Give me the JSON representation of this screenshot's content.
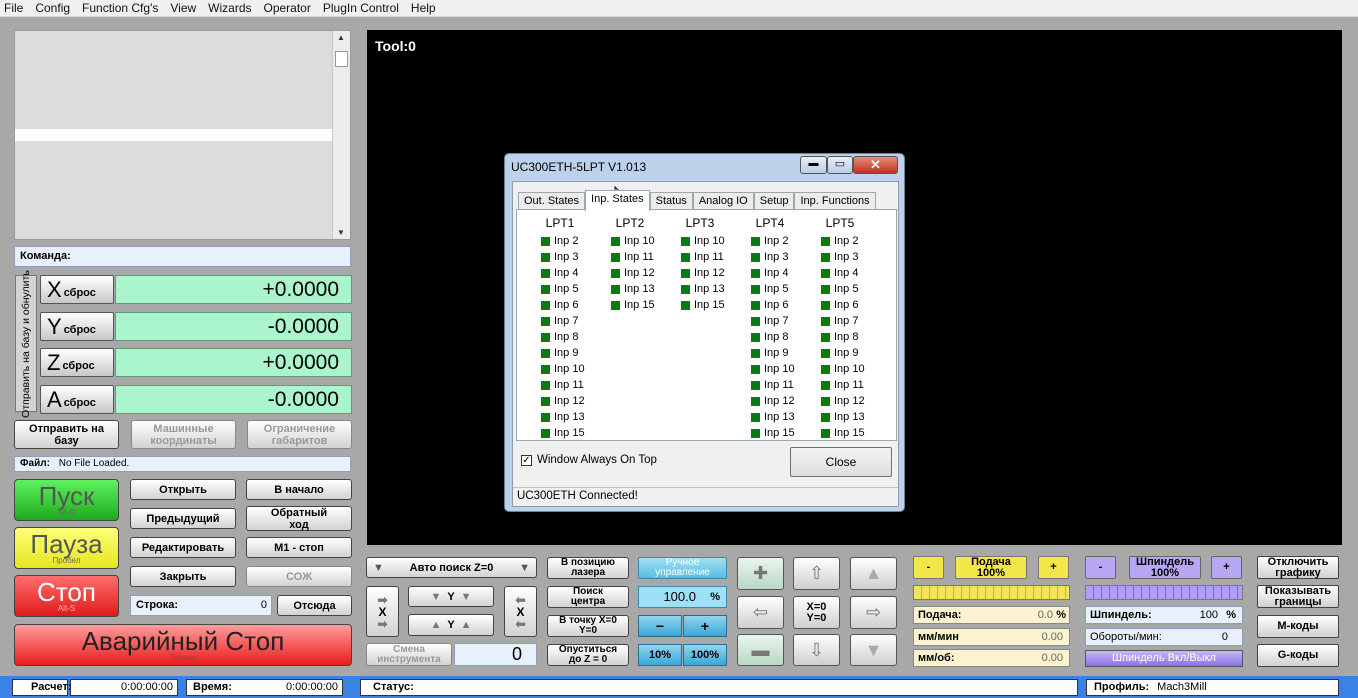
{
  "menu": [
    "File",
    "Config",
    "Function Cfg's",
    "View",
    "Wizards",
    "Operator",
    "PlugIn Control",
    "Help"
  ],
  "command_label": "Команда:",
  "ref_all_label": "Отправить на базу и обнулить",
  "axes": [
    {
      "letter": "X",
      "reset": "сброс",
      "value": "+0.0000"
    },
    {
      "letter": "Y",
      "reset": "сброс",
      "value": "-0.0000"
    },
    {
      "letter": "Z",
      "reset": "сброс",
      "value": "+0.0000"
    },
    {
      "letter": "A",
      "reset": "сброс",
      "value": "-0.0000"
    }
  ],
  "ref_buttons": {
    "home": "Отправить на базу",
    "machine": "Машинные координаты",
    "limits": "Ограничение габаритов"
  },
  "file_label": "Файл:",
  "file_value": "No File Loaded.",
  "run": {
    "start": "Пуск",
    "start_key": "Alt-R",
    "pause": "Пауза",
    "pause_key": "Пробел",
    "stop": "Стоп",
    "stop_key": "Alt-S",
    "estop": "Аварийный Стоп",
    "estop_key": "Тильда"
  },
  "file_buttons": {
    "open": "Открыть",
    "rewind": "В начало",
    "prev": "Предыдущий",
    "reverse": "Обратный ход",
    "edit": "Редактировать",
    "m1": "M1 - стоп",
    "close": "Закрыть",
    "coolant": "СОЖ"
  },
  "line_label": "Строка:",
  "line_value": "0",
  "from_here": "Отсюда",
  "tool_change": "Смена инструмента",
  "tool_value": "0",
  "screen": {
    "tool": "Tool:0"
  },
  "dialog": {
    "title": "UC300ETH-5LPT V1.013",
    "tabs": [
      "Out. States",
      "Inp. States",
      "Status",
      "Analog IO",
      "Setup",
      "Inp. Functions"
    ],
    "lpts": [
      {
        "name": "LPT1",
        "pins": [
          "Inp 2",
          "Inp 3",
          "Inp 4",
          "Inp 5",
          "Inp 6",
          "Inp 7",
          "Inp 8",
          "Inp 9",
          "Inp 10",
          "Inp 11",
          "Inp 12",
          "Inp 13",
          "Inp 15"
        ]
      },
      {
        "name": "LPT2",
        "pins": [
          "Inp 10",
          "Inp 11",
          "Inp 12",
          "Inp 13",
          "Inp 15"
        ]
      },
      {
        "name": "LPT3",
        "pins": [
          "Inp 10",
          "Inp 11",
          "Inp 12",
          "Inp 13",
          "Inp 15"
        ]
      },
      {
        "name": "LPT4",
        "pins": [
          "Inp 2",
          "Inp 3",
          "Inp 4",
          "Inp 5",
          "Inp 6",
          "Inp 7",
          "Inp 8",
          "Inp 9",
          "Inp 10",
          "Inp 11",
          "Inp 12",
          "Inp 13",
          "Inp 15"
        ]
      },
      {
        "name": "LPT5",
        "pins": [
          "Inp 2",
          "Inp 3",
          "Inp 4",
          "Inp 5",
          "Inp 6",
          "Inp 7",
          "Inp 8",
          "Inp 9",
          "Inp 10",
          "Inp 11",
          "Inp 12",
          "Inp 13",
          "Inp 15"
        ]
      }
    ],
    "always_on_top": "Window Always On Top",
    "close": "Close",
    "status": "UC300ETH Connected!"
  },
  "jog": {
    "auto_z": "Авто поиск Z=0",
    "laser": "В позицию лазера",
    "manual": "Ручное управление",
    "find_center": "Поиск центра",
    "jog_pct": "100.0",
    "pct": "%",
    "goto_xy0": "В точку X=0 Y=0",
    "descend_z0": "Опуститься до Z = 0",
    "minus": "−",
    "plus": "+",
    "p10": "10%",
    "p100": "100%",
    "xy0": "X=0 Y=0",
    "x": "X",
    "y": "Y"
  },
  "feed": {
    "minus": "-",
    "plus": "+",
    "label": "Подача 100%",
    "feed_label": "Подача:",
    "feed_value": "0.0",
    "feed_unit": "%",
    "mm_min": "мм/мин",
    "mm_min_value": "0.00",
    "mm_rev": "мм/об:",
    "mm_rev_value": "0.00",
    "level": 1.0
  },
  "spindle": {
    "minus": "-",
    "plus": "+",
    "label": "Шпиндель 100%",
    "spindle_label": "Шпиндель:",
    "spindle_value": "100",
    "spindle_unit": "%",
    "rpm_label": "Обороты/мин:",
    "rpm_value": "0",
    "toggle": "Шпиндель Вкл/Выкл",
    "level": 1.0
  },
  "right_buttons": {
    "graphics": "Отключить графику",
    "bounds": "Показывать границы",
    "mcodes": "М-коды",
    "gcodes": "G-коды"
  },
  "statusbar": {
    "calc": "Расчет:",
    "calc_value": "0:00:00:00",
    "time": "Время:",
    "time_value": "0:00:00:00",
    "status": "Статус:",
    "profile": "Профиль:",
    "profile_value": "Mach3Mill"
  }
}
